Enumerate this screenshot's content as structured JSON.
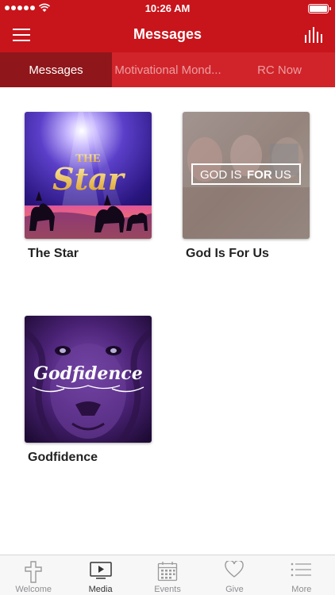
{
  "status_bar": {
    "time": "10:26 AM"
  },
  "nav": {
    "title": "Messages"
  },
  "tabs": [
    {
      "label": "Messages",
      "active": true
    },
    {
      "label": "Motivational Mond...",
      "active": false
    },
    {
      "label": "RC Now",
      "active": false
    }
  ],
  "media": [
    {
      "title": "The Star",
      "art_text": "THE Star"
    },
    {
      "title": "God Is For Us",
      "art_text_1": "GOD IS",
      "art_text_2": "FOR",
      "art_text_3": "US"
    },
    {
      "title": "Godfidence",
      "art_text": "Godfidence"
    }
  ],
  "tab_bar": [
    {
      "label": "Welcome",
      "icon": "cross-icon",
      "active": false
    },
    {
      "label": "Media",
      "icon": "tv-icon",
      "active": true
    },
    {
      "label": "Events",
      "icon": "calendar-icon",
      "active": false
    },
    {
      "label": "Give",
      "icon": "heart-icon",
      "active": false
    },
    {
      "label": "More",
      "icon": "list-icon",
      "active": false
    }
  ],
  "colors": {
    "brand_red": "#c8141b",
    "active_tab": "#8f161a"
  }
}
